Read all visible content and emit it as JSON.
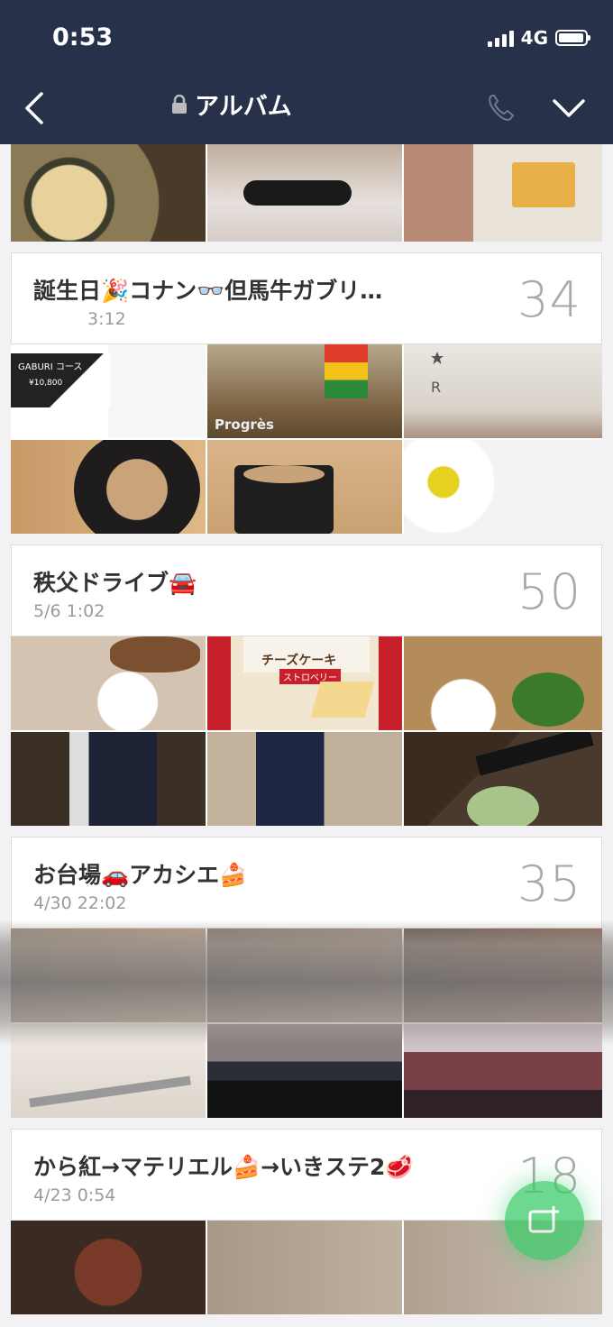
{
  "status_bar": {
    "time": "0:53",
    "network": "4G"
  },
  "header": {
    "title": "アルバム",
    "icons": [
      "back-icon",
      "lock-icon",
      "call-icon",
      "chevron-down-icon"
    ]
  },
  "albums": [
    {
      "name": "誕生日🎉コナン👓但馬牛ガブリ…",
      "date": "3:12",
      "count": "34",
      "photo_texts": {
        "gaburi": "GABURI コース",
        "price": "¥10,800",
        "progres": "Progrès"
      }
    },
    {
      "name": "秩父ドライブ🚘",
      "date": "5/6 1:02",
      "count": "50",
      "photo_texts": {
        "cheesecake": "チーズケーキ",
        "strawberry": "ストロベリー"
      }
    },
    {
      "name": "お台場🚗アカシエ🍰",
      "date": "4/30 22:02",
      "count": "35"
    },
    {
      "name": "から紅→マテリエル🍰→いきステ2🥩",
      "date": "4/23 0:54",
      "count": "18"
    }
  ],
  "colors": {
    "header_bg": "#27324a",
    "fab": "#3dcc6a",
    "count_text": "#a7a8ad"
  }
}
